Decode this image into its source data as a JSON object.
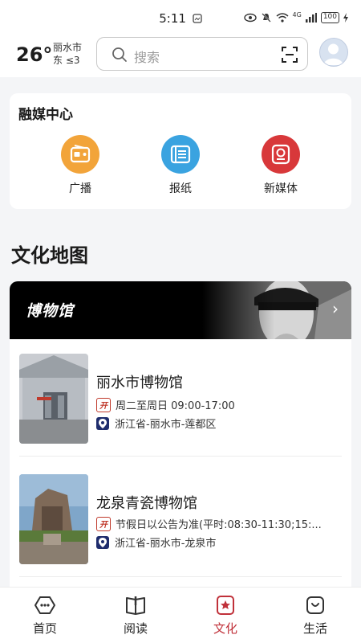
{
  "status_bar": {
    "time": "5:11",
    "battery": "100",
    "network": "4G"
  },
  "header": {
    "temperature": "26°",
    "city": "丽水市",
    "wind": "东 ≤3",
    "search_placeholder": "搜索"
  },
  "media_center": {
    "title": "融媒中心",
    "items": [
      {
        "label": "广播",
        "icon": "radio-icon",
        "color": "#f2a43a"
      },
      {
        "label": "报纸",
        "icon": "newspaper-icon",
        "color": "#3aa3e0"
      },
      {
        "label": "新媒体",
        "icon": "new-media-icon",
        "color": "#d8383a"
      }
    ]
  },
  "culture_map": {
    "title": "文化地图",
    "banner_label": "博物馆",
    "museums": [
      {
        "name": "丽水市博物馆",
        "hours": "周二至周日 09:00-17:00",
        "location": "浙江省-丽水市-莲都区"
      },
      {
        "name": "龙泉青瓷博物馆",
        "hours": "节假日以公告为准(平时:08:30-11:30;15:...",
        "location": "浙江省-丽水市-龙泉市"
      }
    ],
    "open_badge": "开"
  },
  "tabbar": {
    "items": [
      {
        "label": "首页",
        "icon": "home-icon"
      },
      {
        "label": "阅读",
        "icon": "book-icon"
      },
      {
        "label": "文化",
        "icon": "culture-icon"
      },
      {
        "label": "生活",
        "icon": "life-icon"
      }
    ],
    "active_color": "#c0313a"
  }
}
